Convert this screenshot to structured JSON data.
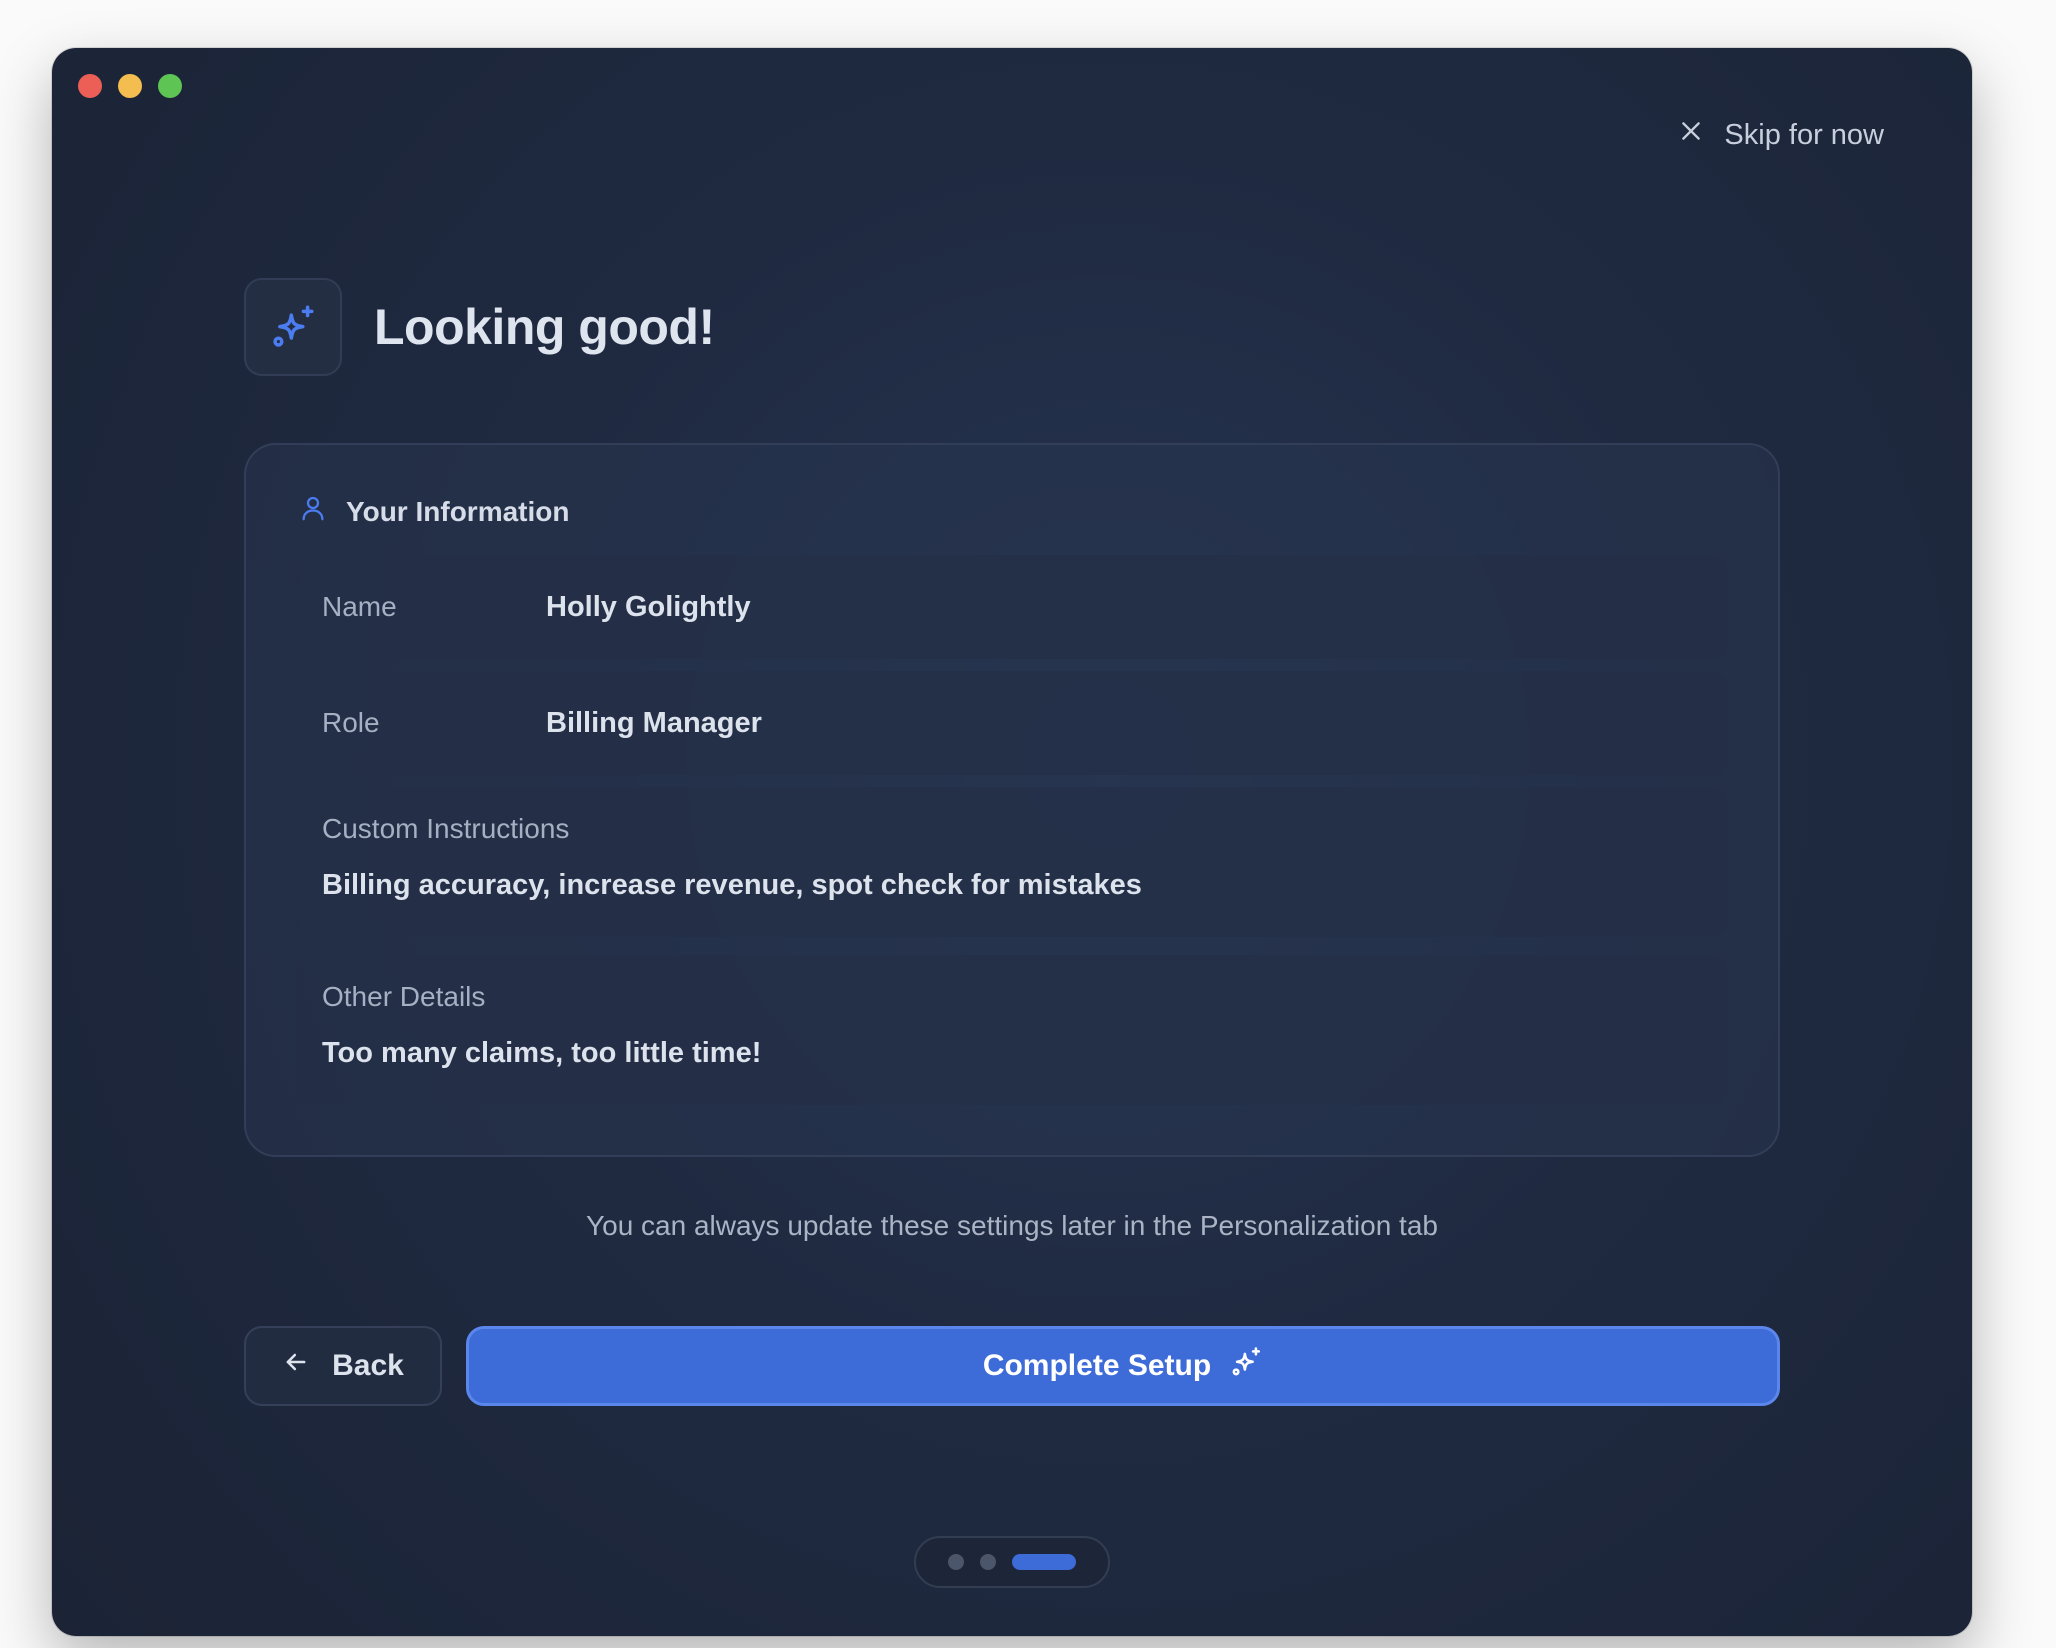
{
  "window": {
    "controls": [
      {
        "name": "close",
        "color": "#ec5f57"
      },
      {
        "name": "minimize",
        "color": "#f4bd4f"
      },
      {
        "name": "maximize",
        "color": "#5ec453"
      }
    ]
  },
  "skip": {
    "label": "Skip for now",
    "icon": "close-icon"
  },
  "hero": {
    "icon": "sparkles-icon",
    "title": "Looking good!"
  },
  "card": {
    "title": "Your Information",
    "icon": "user-icon",
    "fields": {
      "name": {
        "label": "Name",
        "value": "Holly Golightly"
      },
      "role": {
        "label": "Role",
        "value": "Billing Manager"
      },
      "custom_instructions": {
        "label": "Custom Instructions",
        "value": "Billing accuracy, increase revenue, spot check for mistakes"
      },
      "other_details": {
        "label": "Other Details",
        "value": "Too many claims, too little time!"
      }
    }
  },
  "hint": "You can always update these settings later in the Personalization tab",
  "actions": {
    "back": {
      "label": "Back",
      "icon": "arrow-left-icon"
    },
    "complete": {
      "label": "Complete Setup",
      "icon": "sparkles-icon"
    }
  },
  "pagination": {
    "total_steps": 3,
    "current_step": 3
  },
  "colors": {
    "accent": "#3d6bd8",
    "background": "#1f2a41",
    "text": "#dde3ec",
    "muted": "#a5b0c2"
  }
}
